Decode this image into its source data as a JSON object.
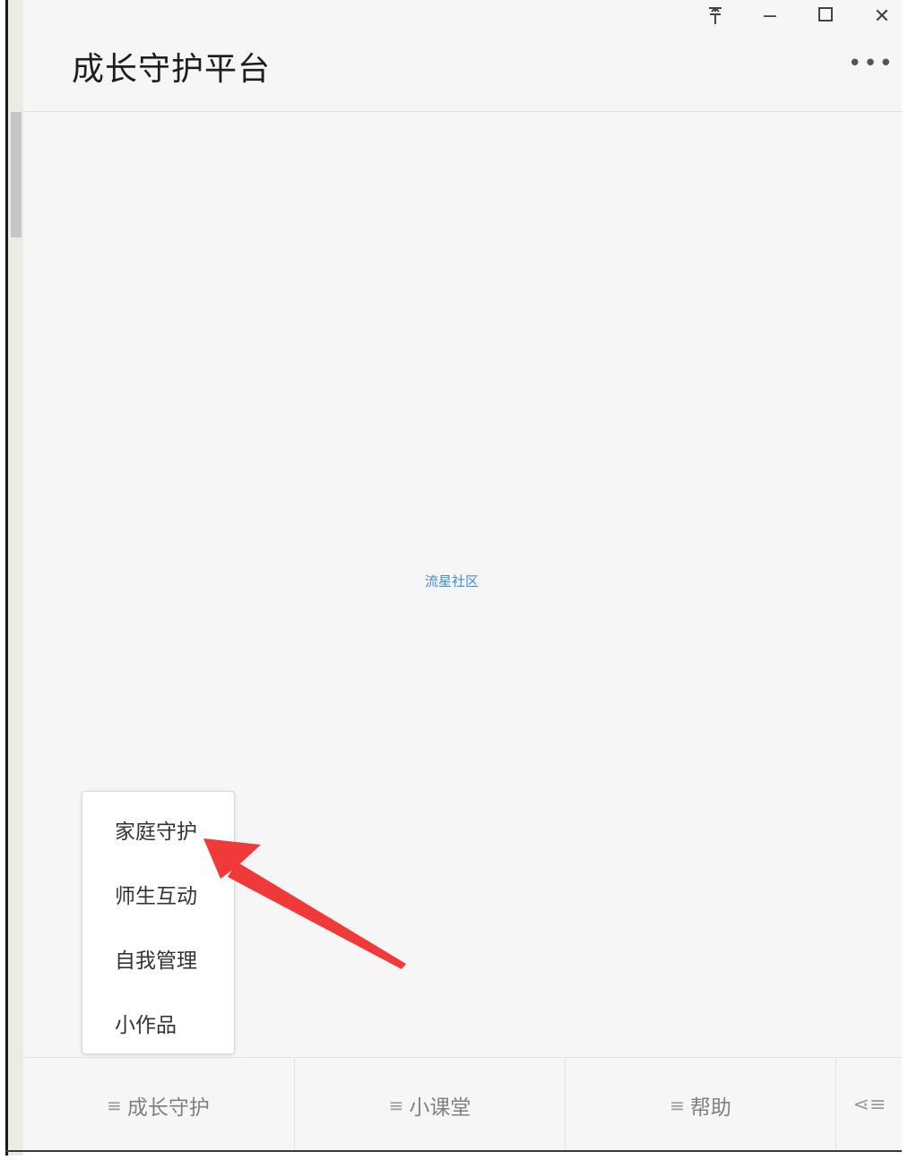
{
  "app": {
    "title": "成长守护平台"
  },
  "window_controls": {
    "pin": "⚲",
    "minimize": "−",
    "maximize": "☐",
    "close": "✕",
    "more": "•••"
  },
  "watermark": "流星社区",
  "popup_menu": {
    "items": [
      {
        "label": "家庭守护"
      },
      {
        "label": "师生互动"
      },
      {
        "label": "自我管理"
      },
      {
        "label": "小作品"
      }
    ]
  },
  "tabbar": {
    "tabs": [
      {
        "label": "成长守护",
        "icon": "≡"
      },
      {
        "label": "小课堂",
        "icon": "≡"
      },
      {
        "label": "帮助",
        "icon": "≡"
      },
      {
        "label": "",
        "icon": "⋖≡"
      }
    ]
  },
  "colors": {
    "accent_arrow": "#f03a3a",
    "watermark": "#3c8de0",
    "background": "#f6f6f6"
  }
}
